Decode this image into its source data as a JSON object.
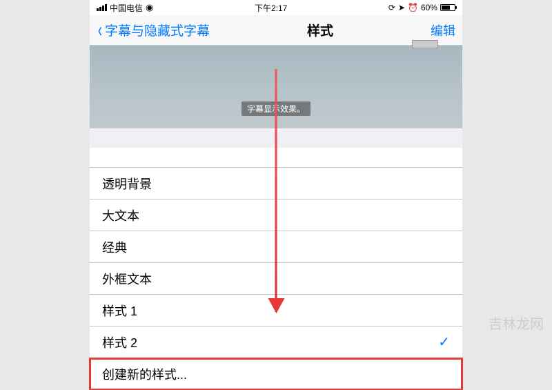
{
  "status": {
    "carrier": "中国电信",
    "time": "下午2:17",
    "battery_pct": "60%"
  },
  "nav": {
    "back_label": "字幕与隐藏式字幕",
    "title": "样式",
    "edit": "编辑"
  },
  "preview": {
    "subtitle_text": "字幕显示效果。"
  },
  "styles": [
    {
      "label": "透明背景",
      "selected": false
    },
    {
      "label": "大文本",
      "selected": false
    },
    {
      "label": "经典",
      "selected": false
    },
    {
      "label": "外框文本",
      "selected": false
    },
    {
      "label": "样式 1",
      "selected": false
    },
    {
      "label": "样式 2",
      "selected": true
    }
  ],
  "create_new": "创建新的样式...",
  "watermark": "吉林龙网"
}
